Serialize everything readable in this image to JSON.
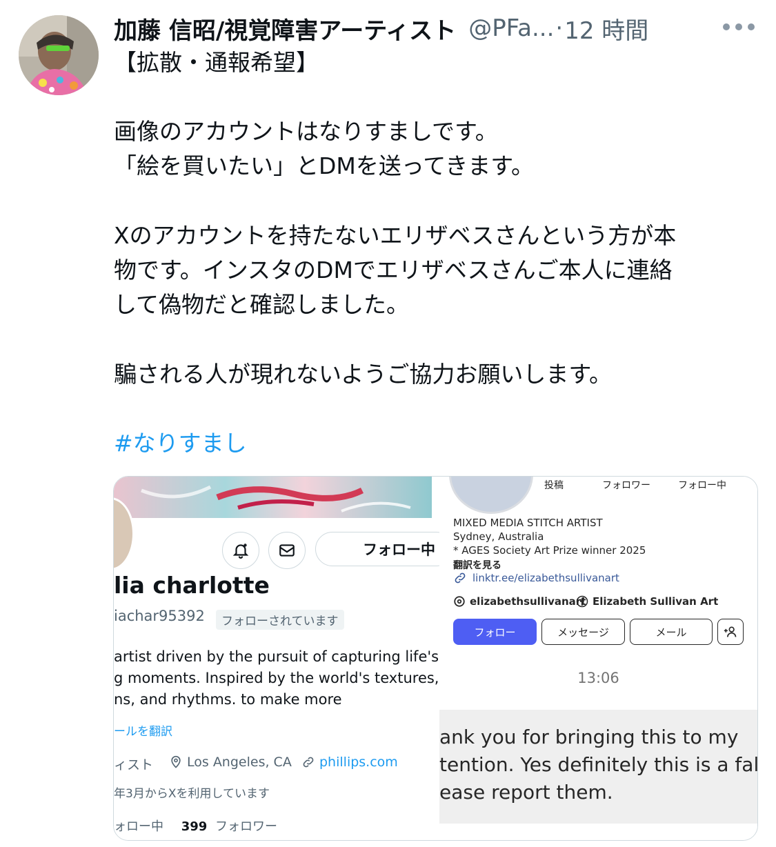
{
  "tweet": {
    "author_name": "加藤 信昭/視覚障害アーティスト",
    "handle": "@PFa...",
    "separator": "·",
    "time": "12 時間",
    "more_icon": "more-horizontal-icon",
    "lines": [
      "【拡散・通報希望】",
      "画像のアカウントはなりすましです。",
      "「絵を買いたい」とDMを送ってきます。",
      "Xのアカウントを持たないエリザベスさんという方が本",
      "物です。インスタのDMでエリザベスさんご本人に連絡",
      "して偽物だと確認しました。",
      "騙される人が現れないようご協力お願いします。"
    ],
    "hashtag": "#なりすまし",
    "hashtag_color": "#1d9bf0"
  },
  "x_profile": {
    "follow_button": "フォロー中",
    "name": "lia charlotte",
    "handle": "iachar95392",
    "follows_you": "フォローされています",
    "bio": [
      "artist driven by the pursuit of capturing life's",
      "g moments. Inspired by the world's textures,",
      "ns, and rhythms. to make more"
    ],
    "translate": "ールを翻訳",
    "category": "ィスト",
    "location": "Los Angeles, CA",
    "link": "phillips.com",
    "joined": "年3月からXを利用しています",
    "following_label": "ォロー中",
    "followers_count": "399",
    "followers_label": "フォロワー"
  },
  "ig_profile": {
    "stats": [
      "投稿",
      "フォロワー",
      "フォロー中"
    ],
    "category": "MIXED MEDIA STITCH ARTIST",
    "location": "Sydney, Australia",
    "award": "* AGES Society Art Prize winner 2025",
    "translate": "翻訳を見る",
    "link": "linktr.ee/elizabethsullivanart",
    "threads": "elizabethsullivanart",
    "facebook": "Elizabeth Sullivan Art",
    "buttons": {
      "follow": "フォロー",
      "message": "メッセージ",
      "email": "メール"
    },
    "accent": "#4e5ef3"
  },
  "dm": {
    "time": "13:06",
    "lines": [
      "ank you for bringing this to my",
      "tention. Yes definitely this is a fal",
      "ease report them."
    ]
  }
}
